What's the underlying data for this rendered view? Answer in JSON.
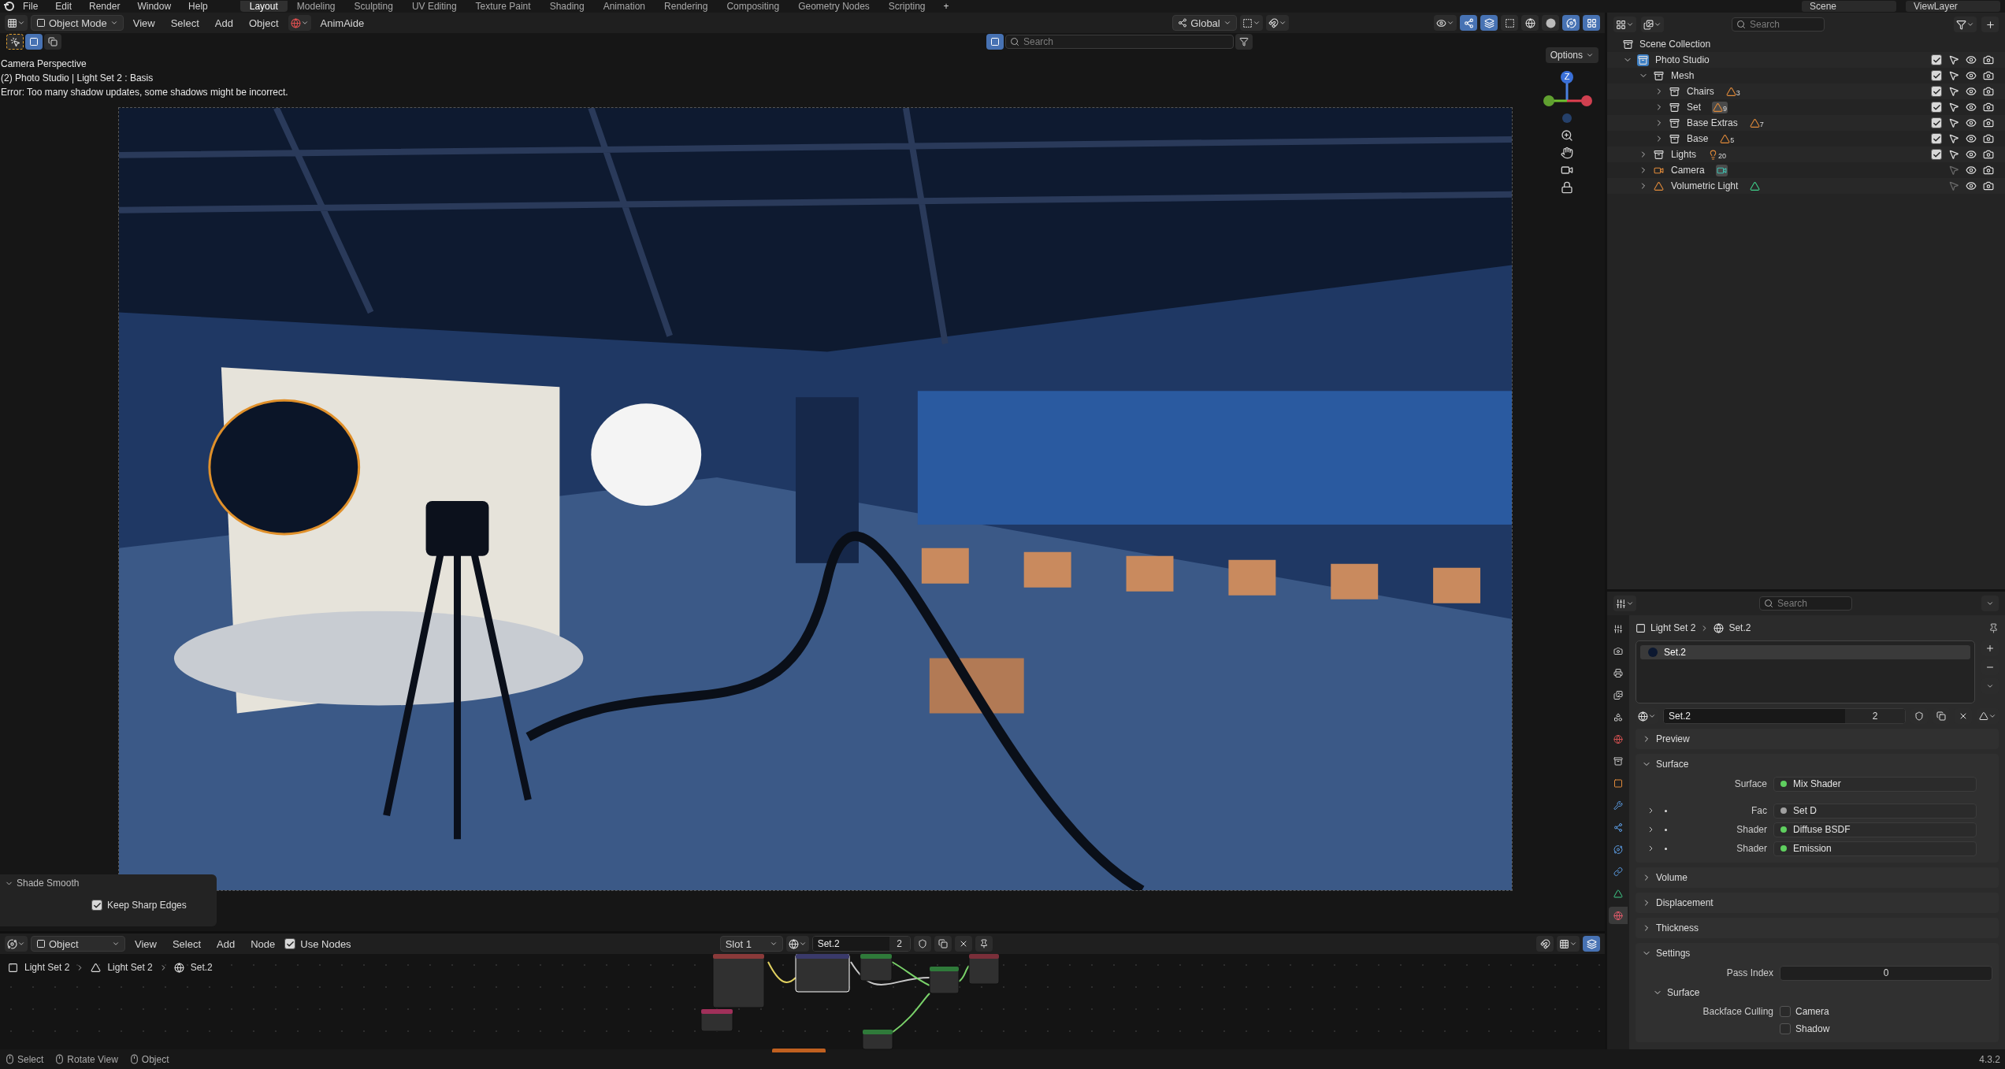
{
  "top_menu": [
    "File",
    "Edit",
    "Render",
    "Window",
    "Help"
  ],
  "workspaces": [
    {
      "label": "Layout",
      "selected": true
    },
    {
      "label": "Modeling",
      "selected": false
    },
    {
      "label": "Sculpting",
      "selected": false
    },
    {
      "label": "UV Editing",
      "selected": false
    },
    {
      "label": "Texture Paint",
      "selected": false
    },
    {
      "label": "Shading",
      "selected": false
    },
    {
      "label": "Animation",
      "selected": false
    },
    {
      "label": "Rendering",
      "selected": false
    },
    {
      "label": "Compositing",
      "selected": false
    },
    {
      "label": "Geometry Nodes",
      "selected": false
    },
    {
      "label": "Scripting",
      "selected": false
    }
  ],
  "add_workspace": "+",
  "scene": {
    "scene_name": "Scene",
    "view_layer": "ViewLayer"
  },
  "viewport": {
    "mode": "Object Mode",
    "menus": [
      "View",
      "Select",
      "Add",
      "Object"
    ],
    "addon": "AnimAide",
    "orientation": "Global",
    "search_placeholder": "Search",
    "options": "Options",
    "overlay_text": [
      "Camera Perspective",
      "(2) Photo Studio | Light Set 2 : Basis",
      "Error: Too many shadow updates, some shadows might be incorrect."
    ],
    "gizmo_label": "Z",
    "last_operator": {
      "title": "Shade Smooth",
      "expanded": true,
      "options": [
        {
          "label": "Keep Sharp Edges",
          "checked": true
        }
      ]
    }
  },
  "node_editor": {
    "object": "Object",
    "menus": [
      "View",
      "Select",
      "Add",
      "Node"
    ],
    "use_nodes": {
      "label": "Use Nodes",
      "checked": true
    },
    "slot": "Slot 1",
    "material": "Set.2",
    "users": "2",
    "breadcrumbs": [
      "Light Set 2",
      "Light Set 2",
      "Set.2"
    ]
  },
  "outliner": {
    "search_placeholder": "Search",
    "root": "Scene Collection",
    "items": [
      {
        "label": "Photo Studio",
        "kind": "collection",
        "active": true,
        "expanded": true,
        "checked": true,
        "selectable": true,
        "children": [
          {
            "label": "Mesh",
            "kind": "collection",
            "active": false,
            "expanded": true,
            "checked": true,
            "selectable": true,
            "children": [
              {
                "label": "Chairs",
                "kind": "collection",
                "active": false,
                "expanded": false,
                "checked": true,
                "selectable": true,
                "badge": {
                  "kind": "mesh",
                  "count": "3",
                  "highlighted": false
                }
              },
              {
                "label": "Set",
                "kind": "collection",
                "active": false,
                "expanded": false,
                "checked": true,
                "selectable": true,
                "badge": {
                  "kind": "mesh",
                  "count": "9",
                  "highlighted": true
                }
              },
              {
                "label": "Base Extras",
                "kind": "collection",
                "active": false,
                "expanded": false,
                "checked": true,
                "selectable": true,
                "badge": {
                  "kind": "mesh",
                  "count": "7",
                  "highlighted": false
                }
              },
              {
                "label": "Base",
                "kind": "collection",
                "active": false,
                "expanded": false,
                "checked": true,
                "selectable": true,
                "badge": {
                  "kind": "mesh",
                  "count": "5",
                  "highlighted": false
                }
              }
            ]
          },
          {
            "label": "Lights",
            "kind": "collection",
            "active": false,
            "expanded": false,
            "checked": true,
            "selectable": true,
            "badge": {
              "kind": "light",
              "count": "20",
              "highlighted": false
            }
          },
          {
            "label": "Camera",
            "kind": "camera",
            "active": false,
            "expanded": false,
            "selectable": false,
            "badge": {
              "kind": "camera_data",
              "highlighted": true
            }
          },
          {
            "label": "Volumetric Light",
            "kind": "mesh_object",
            "active": false,
            "expanded": false,
            "selectable": false,
            "badge": {
              "kind": "mesh_data",
              "highlighted": false
            }
          }
        ]
      }
    ]
  },
  "properties": {
    "search_placeholder": "Search",
    "tabs": [
      {
        "kind": "tool",
        "selected": false
      },
      {
        "kind": "render",
        "selected": false
      },
      {
        "kind": "output",
        "selected": false
      },
      {
        "kind": "view_layer",
        "selected": false
      },
      {
        "kind": "scene",
        "selected": false
      },
      {
        "kind": "world",
        "selected": false
      },
      {
        "kind": "collection",
        "selected": false
      },
      {
        "kind": "object",
        "selected": false
      },
      {
        "kind": "modifiers",
        "selected": false
      },
      {
        "kind": "particles",
        "selected": false
      },
      {
        "kind": "physics",
        "selected": false
      },
      {
        "kind": "constraints",
        "selected": false
      },
      {
        "kind": "data",
        "selected": false
      },
      {
        "kind": "material",
        "selected": true
      }
    ],
    "breadcrumbs": [
      "Light Set 2",
      "Set.2"
    ],
    "slots": [
      {
        "name": "Set.2",
        "selected": true
      }
    ],
    "material": "Set.2",
    "users": "2",
    "panels": [
      {
        "title": "Preview",
        "expanded": false
      },
      {
        "title": "Surface",
        "expanded": true,
        "rows": [
          {
            "label": "Surface",
            "value": "Mix Shader",
            "color": "#5fcf5f",
            "expandable": false
          },
          {
            "label": "Fac",
            "value": "Set D",
            "color": "#a0a0a0",
            "expandable": true
          },
          {
            "label": "Shader",
            "value": "Diffuse BSDF",
            "color": "#5fcf5f",
            "expandable": true
          },
          {
            "label": "Shader",
            "value": "Emission",
            "color": "#5fcf5f",
            "expandable": true
          }
        ]
      },
      {
        "title": "Volume",
        "expanded": false
      },
      {
        "title": "Displacement",
        "expanded": false
      },
      {
        "title": "Thickness",
        "expanded": false
      },
      {
        "title": "Settings",
        "expanded": true,
        "pass_index": {
          "label": "Pass Index",
          "value": "0"
        },
        "subpanel": {
          "title": "Surface",
          "expanded": true,
          "label": "Backface Culling",
          "options": [
            {
              "label": "Camera",
              "checked": false
            },
            {
              "label": "Shadow",
              "checked": false
            }
          ]
        }
      }
    ]
  },
  "status_bar": {
    "hints": [
      "Select",
      "Rotate View",
      "Object"
    ],
    "version": "4.3.2"
  }
}
